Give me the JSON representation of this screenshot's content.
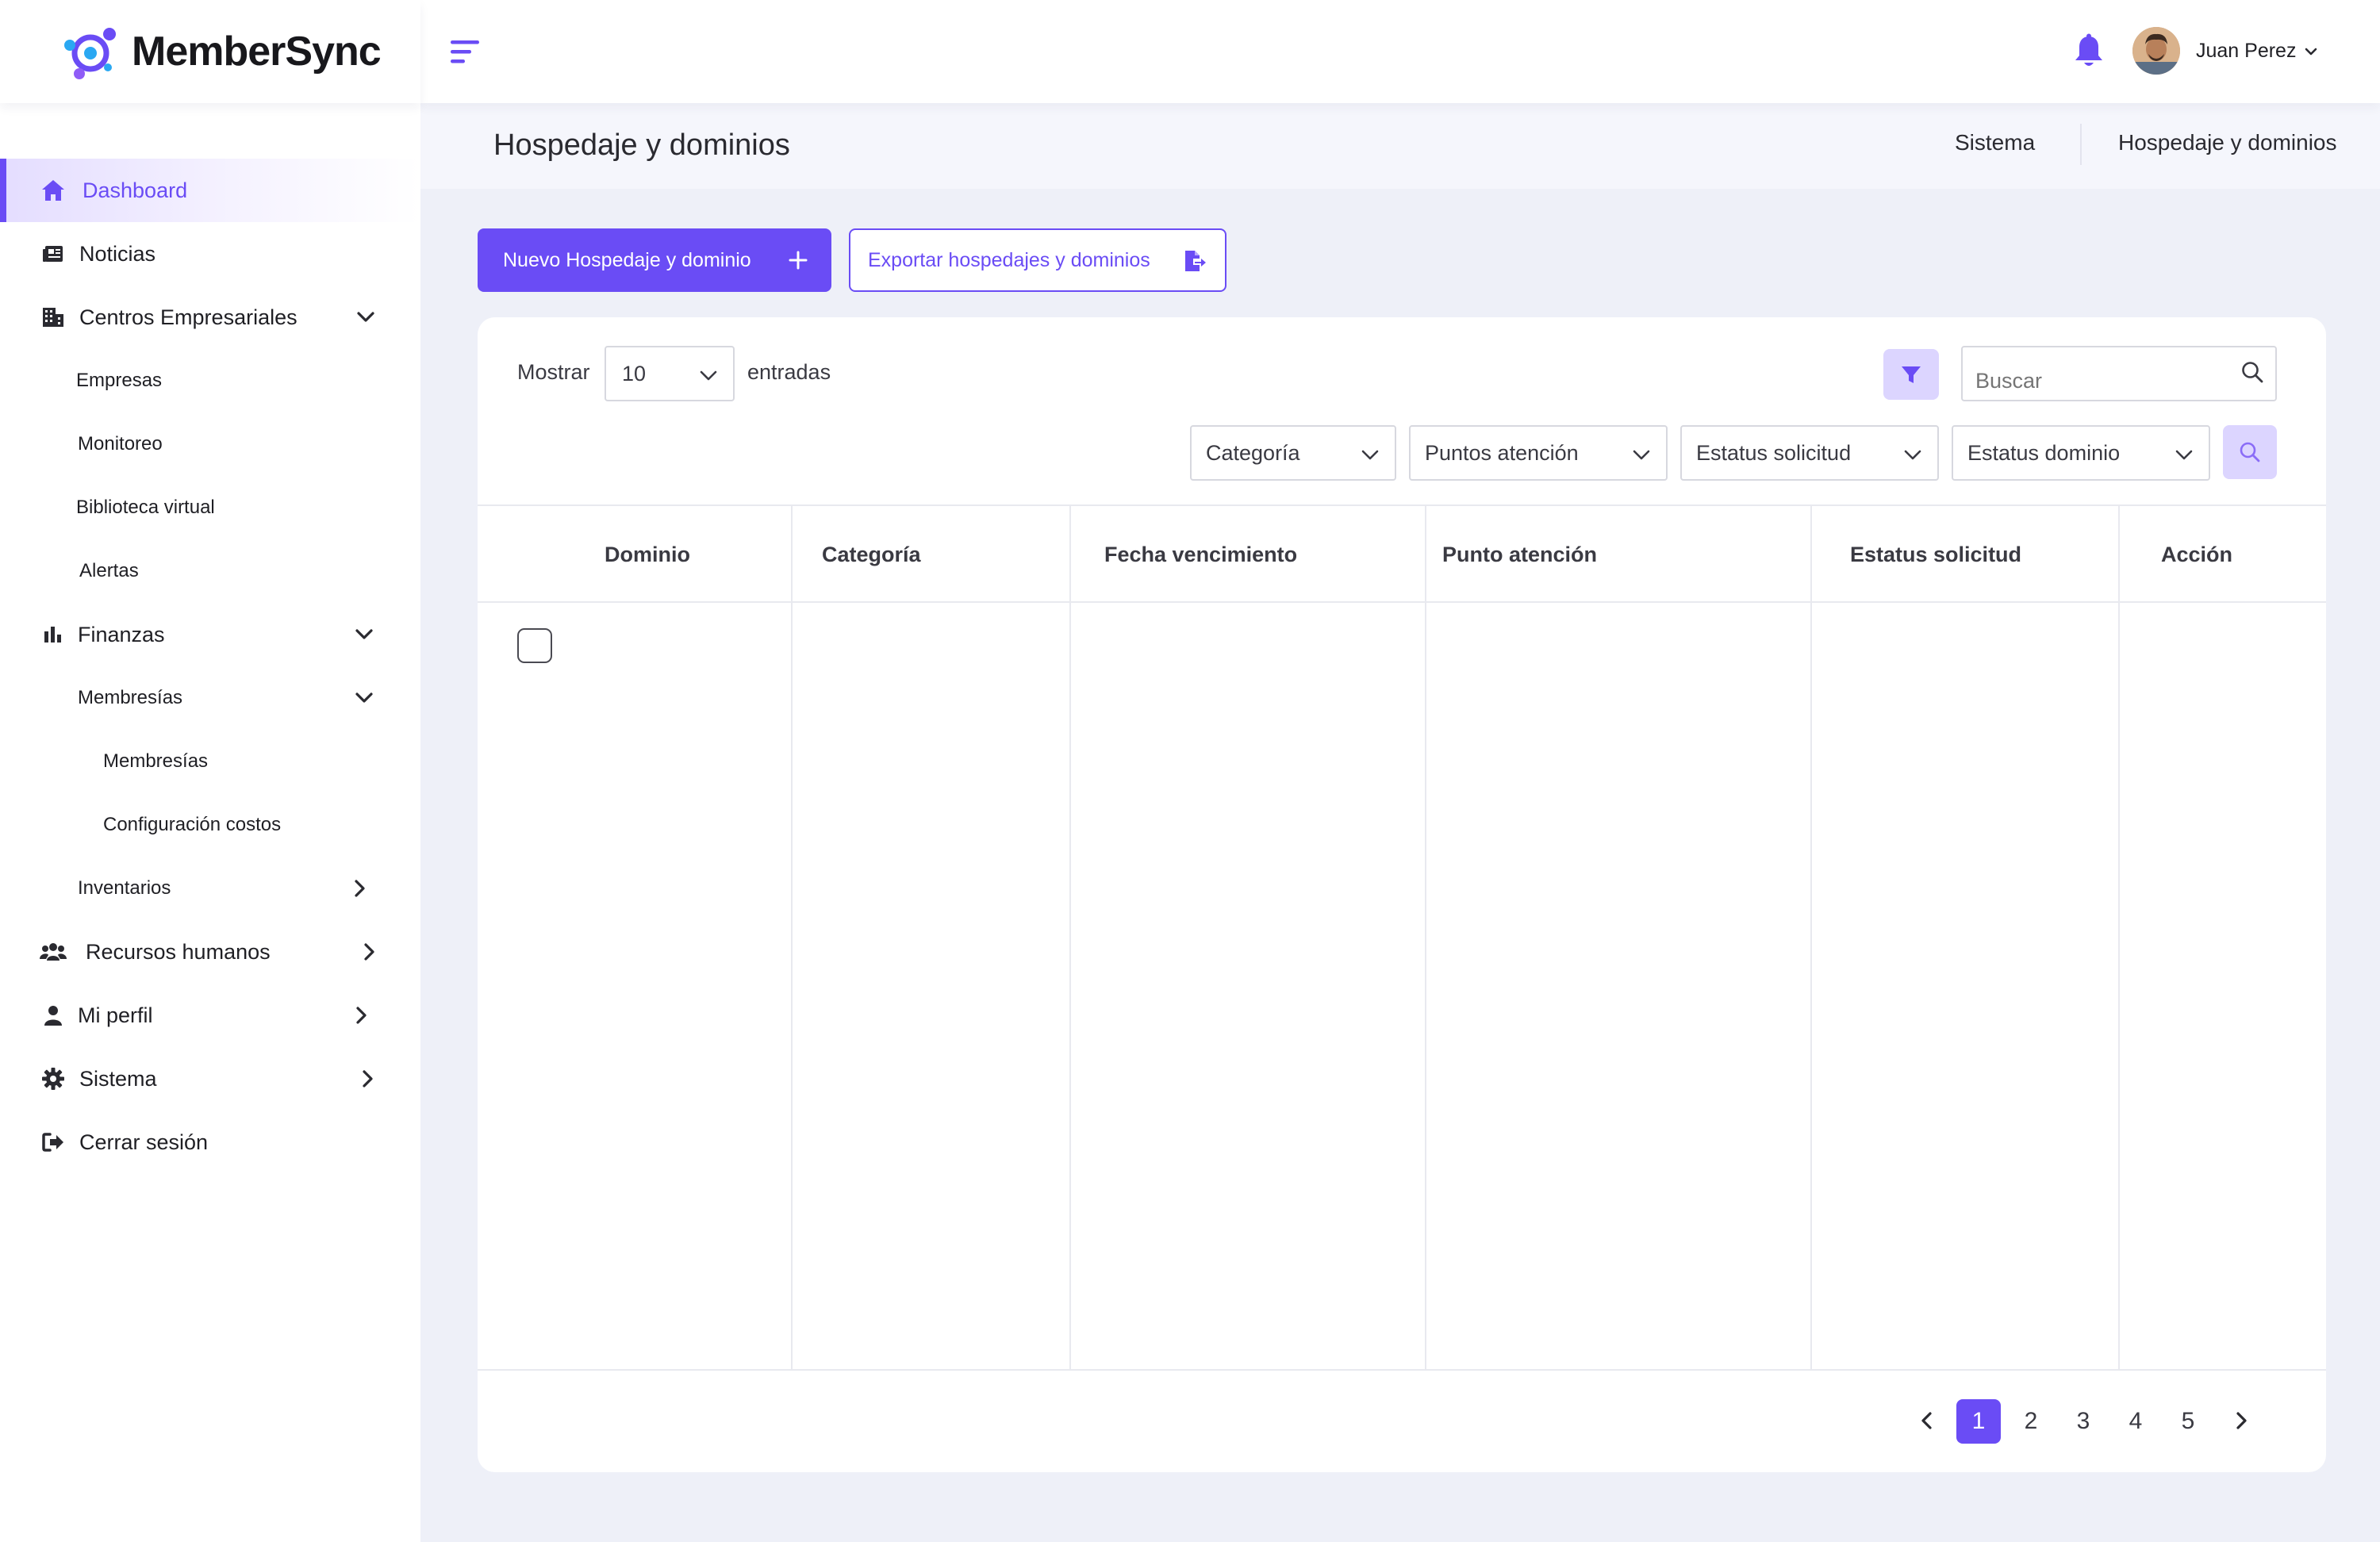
{
  "brand": {
    "name": "MemberSync"
  },
  "colors": {
    "accent": "#6a4cf5",
    "accent_light": "#dcd5ff",
    "background": "#eef0f8"
  },
  "topbar": {
    "menu_icon": "hamburger-icon",
    "notification_icon": "bell-icon",
    "user_name": "Juan Perez"
  },
  "sidebar": {
    "items": [
      {
        "label": "Dashboard",
        "icon": "home-icon",
        "active": true
      },
      {
        "label": "Noticias",
        "icon": "newspaper-icon"
      },
      {
        "label": "Centros Empresariales",
        "icon": "building-icon",
        "expanded": true
      },
      {
        "label": "Empresas"
      },
      {
        "label": "Monitoreo"
      },
      {
        "label": "Biblioteca virtual"
      },
      {
        "label": "Alertas"
      },
      {
        "label": "Finanzas",
        "icon": "chart-icon",
        "expanded": true
      },
      {
        "label": "Membresías",
        "expanded": true
      },
      {
        "label": "Membresías"
      },
      {
        "label": "Configuración costos"
      },
      {
        "label": "Inventarios"
      },
      {
        "label": "Recursos humanos",
        "icon": "users-icon"
      },
      {
        "label": "Mi perfil",
        "icon": "user-icon"
      },
      {
        "label": "Sistema",
        "icon": "gear-icon"
      },
      {
        "label": "Cerrar sesión",
        "icon": "logout-icon"
      }
    ]
  },
  "page": {
    "title": "Hospedaje y dominios",
    "breadcrumb": [
      "Sistema",
      "Hospedaje y dominios"
    ]
  },
  "actions": {
    "new_label": "Nuevo Hospedaje y dominio",
    "export_label": "Exportar hospedajes y dominios"
  },
  "table_controls": {
    "show_label": "Mostrar",
    "page_size": "10",
    "entries_label": "entradas",
    "search_placeholder": "Buscar",
    "filters": [
      "Categoría",
      "Puntos atención",
      "Estatus solicitud",
      "Estatus dominio"
    ]
  },
  "table": {
    "columns": [
      "Dominio",
      "Categoría",
      "Fecha vencimiento",
      "Punto atención",
      "Estatus solicitud",
      "Acción"
    ],
    "rows": []
  },
  "pagination": {
    "pages": [
      "1",
      "2",
      "3",
      "4",
      "5"
    ],
    "current": "1"
  }
}
